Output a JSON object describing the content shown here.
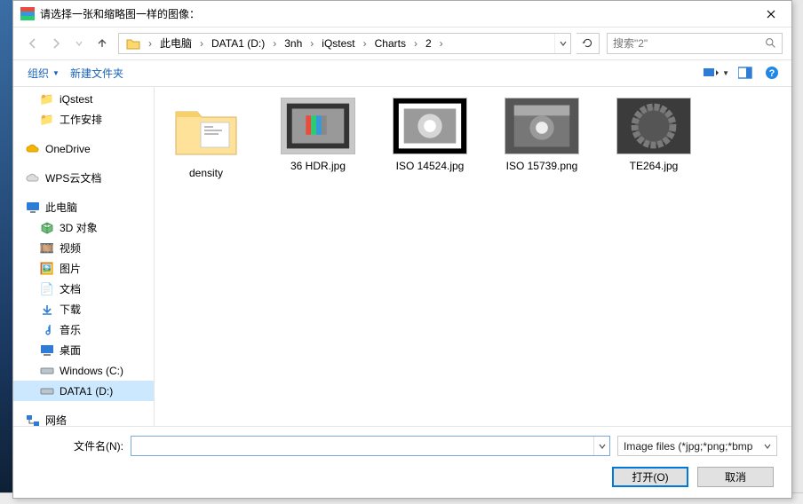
{
  "title": "请选择一张和缩略图一样的图像：",
  "breadcrumb": {
    "pc": "此电脑",
    "d": "DATA1 (D:)",
    "p1": "3nh",
    "p2": "iQstest",
    "p3": "Charts",
    "p4": "2"
  },
  "search": {
    "placeholder": "搜索\"2\""
  },
  "toolbar": {
    "organize": "组织",
    "newfolder": "新建文件夹"
  },
  "tree": {
    "iqstest": "iQstest",
    "work": "工作安排",
    "onedrive": "OneDrive",
    "wps": "WPS云文档",
    "thispc": "此电脑",
    "obj3d": "3D 对象",
    "video": "视频",
    "pics": "图片",
    "docs": "文档",
    "downloads": "下载",
    "music": "音乐",
    "desktop": "桌面",
    "c": "Windows (C:)",
    "d": "DATA1 (D:)",
    "network": "网络"
  },
  "files": {
    "f0": "density",
    "f1": "36 HDR.jpg",
    "f2": "ISO 14524.jpg",
    "f3": "ISO 15739.png",
    "f4": "TE264.jpg"
  },
  "bottom": {
    "filename_label": "文件名(N):",
    "filter": "Image files  (*jpg;*png;*bmp",
    "open": "打开(O)",
    "cancel": "取消"
  }
}
